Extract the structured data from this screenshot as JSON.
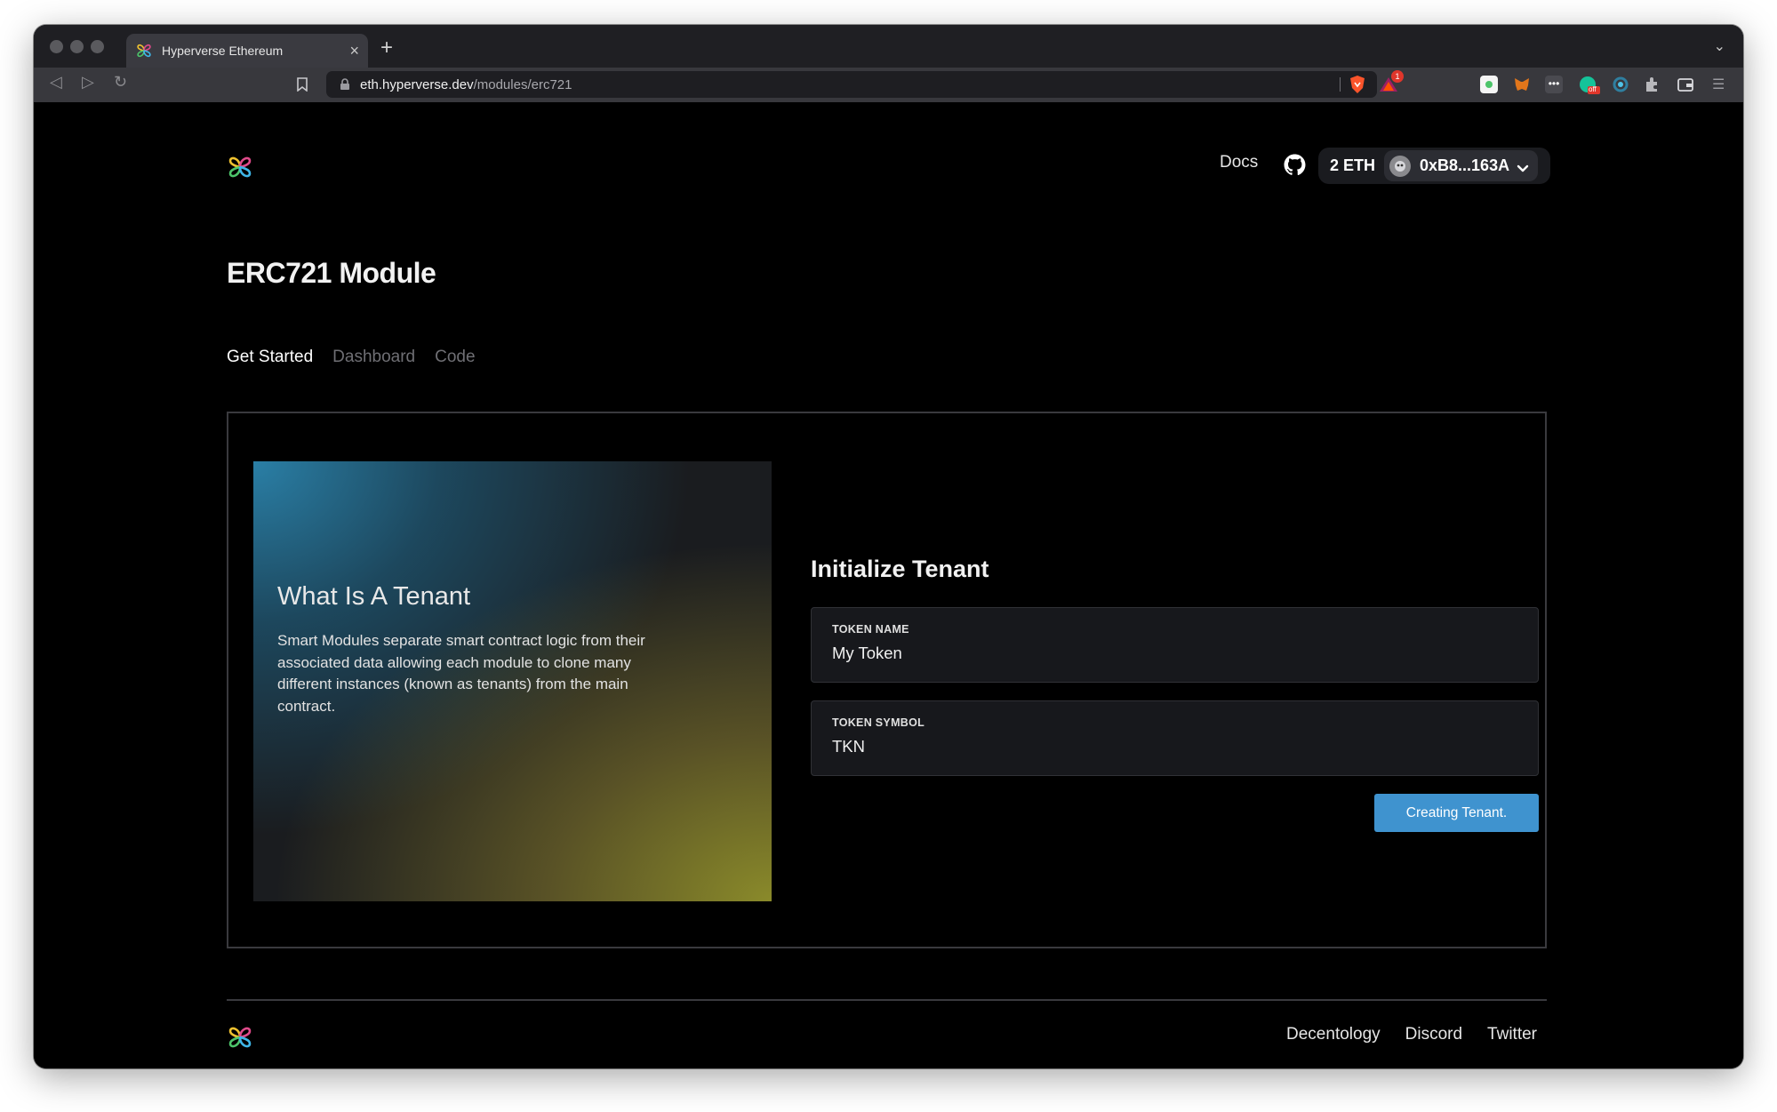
{
  "browser": {
    "tab_title": "Hyperverse Ethereum",
    "new_tab": "+",
    "tab_close": "×",
    "url_host": "eth.hyperverse.dev",
    "url_path": "/modules/erc721",
    "rewards_badge": "1",
    "extension_badge": "off"
  },
  "header": {
    "docs_label": "Docs",
    "balance": "2 ETH",
    "account": "0xB8...163A"
  },
  "page": {
    "title": "ERC721 Module",
    "tabs": [
      {
        "label": "Get Started"
      },
      {
        "label": "Dashboard"
      },
      {
        "label": "Code"
      }
    ]
  },
  "hero": {
    "title": "What Is A Tenant",
    "text": "Smart Modules separate smart contract logic from their associated data allowing each module to clone many different instances (known as tenants) from the main contract."
  },
  "form": {
    "title": "Initialize Tenant",
    "token_name_label": "TOKEN NAME",
    "token_name_value": "My Token",
    "token_symbol_label": "TOKEN SYMBOL",
    "token_symbol_value": "TKN",
    "submit_label": "Creating Tenant."
  },
  "footer": {
    "links": [
      {
        "label": "Decentology"
      },
      {
        "label": "Discord"
      },
      {
        "label": "Twitter"
      }
    ]
  },
  "colors": {
    "accent_button": "#3f93cf",
    "page_background": "#000000",
    "logo_colors": [
      "#f0c230",
      "#e04a8a",
      "#3fb6e8",
      "#4cc46a"
    ]
  }
}
